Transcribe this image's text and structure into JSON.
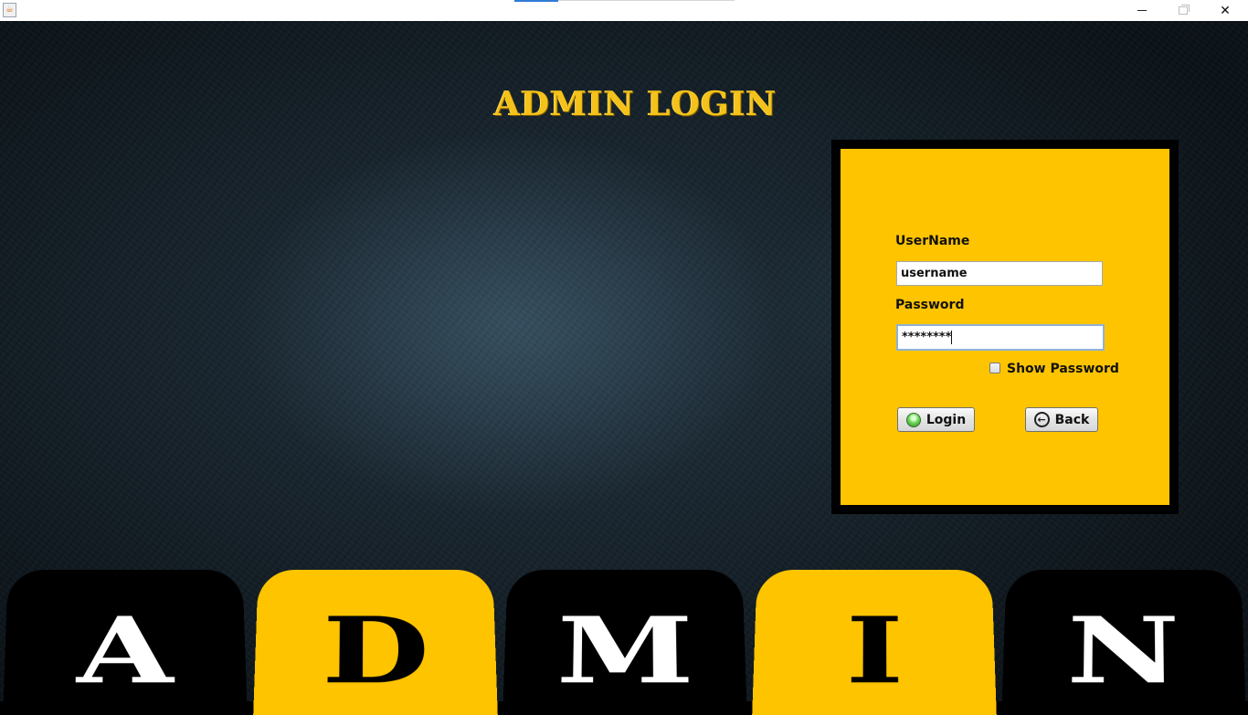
{
  "window": {
    "title": "",
    "icon": "java-cup-icon",
    "controls": {
      "minimize": "minimize",
      "maximize": "maximize",
      "close": "close"
    }
  },
  "page": {
    "title": "ADMIN LOGIN"
  },
  "login_form": {
    "username_label": "UserName",
    "username_value": "username",
    "password_label": "Password",
    "password_masked": "********",
    "show_password_label": "Show Password",
    "show_password_checked": false,
    "login_button": "Login",
    "back_button": "Back"
  },
  "tiles": [
    {
      "letter": "A",
      "color": "black"
    },
    {
      "letter": "D",
      "color": "yellow"
    },
    {
      "letter": "M",
      "color": "black"
    },
    {
      "letter": "I",
      "color": "yellow"
    },
    {
      "letter": "N",
      "color": "black"
    }
  ],
  "colors": {
    "accent_yellow": "#ffc400",
    "title_gold": "#f4c21a",
    "panel_frame": "#000000"
  }
}
